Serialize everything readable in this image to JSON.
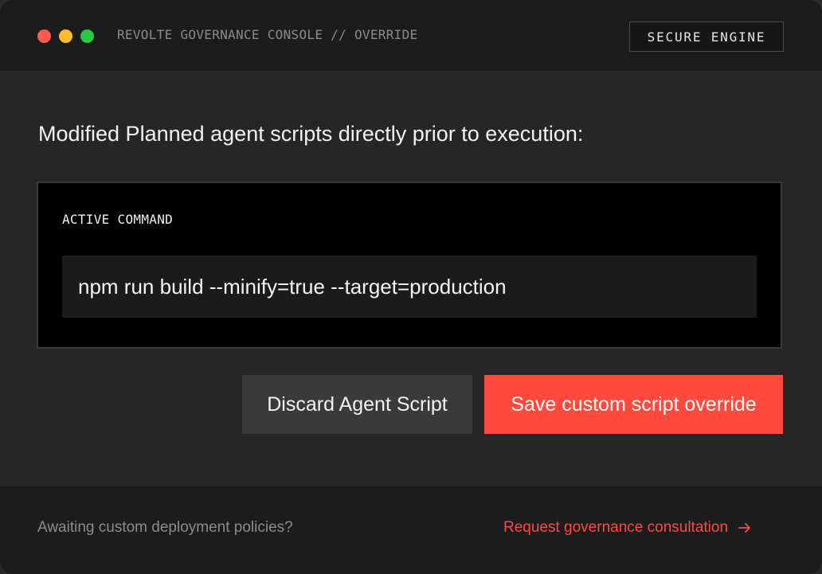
{
  "window": {
    "title": "REVOLTE GOVERNANCE CONSOLE // OVERRIDE",
    "badge": "SECURE ENGINE",
    "traffic_lights": {
      "close_color": "#ff5a4f",
      "minimize_color": "#febc2e",
      "maximize_color": "#28c840"
    }
  },
  "main": {
    "headline": "Modified Planned agent scripts directly prior to execution:",
    "command_label": "ACTIVE COMMAND",
    "command_value": "npm run build --minify=true --target=production"
  },
  "actions": {
    "discard_label": "Discard Agent Script",
    "save_label": "Save custom script override"
  },
  "footer": {
    "note": "Awaiting custom deployment policies?",
    "link_label": "Request governance consultation",
    "link_icon": "arrow-right-icon"
  },
  "colors": {
    "accent": "#ff4a3d",
    "background": "#262626"
  }
}
